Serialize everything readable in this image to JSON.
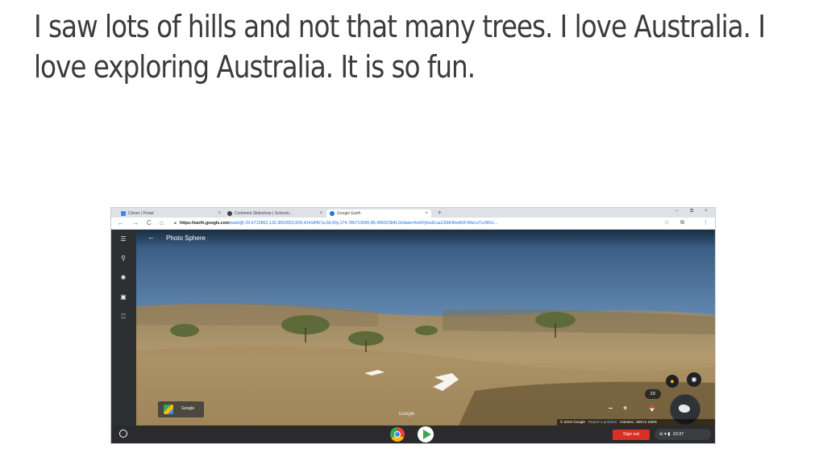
{
  "slide": {
    "text": "I saw lots of hills and not that many trees. I love Australia. I love exploring Australia. It is so fun."
  },
  "browser": {
    "tabs": [
      {
        "label": "Clever | Portal",
        "color": "#4285f4",
        "active": false
      },
      {
        "label": "Continent Slideshow | Schoolo...",
        "color": "#3c4043",
        "active": false
      },
      {
        "label": "Google Earth",
        "color": "#1a73e8",
        "active": true
      }
    ],
    "tab_close": "×",
    "new_tab": "+",
    "window_controls": [
      "–",
      "⧉",
      "×"
    ],
    "url_host": "https://earth.google.com",
    "url_path": "/web/@-23.6713862,132.3652652,829.41418457a,0d,60y,174.78671359h,85.49552384t,0r/data=ihoKFjhsdi1sa2J0dHNoM1F4NzcxTzJiR2c...",
    "nav": {
      "back": "←",
      "forward": "→",
      "reload": "C",
      "home": "⌂"
    },
    "toolbar_icons": {
      "star": "☆",
      "extension": "⧉",
      "menu": "⋮"
    }
  },
  "earth": {
    "view_title": "Photo Sphere",
    "back": "←",
    "rail_icons": [
      "☰",
      "⚲",
      "✺",
      "▣",
      "⎕"
    ],
    "thumb_label": "Google",
    "google_mark": "Google",
    "footer": {
      "copyright": "© 2019 Google",
      "report": "Report a problem",
      "camera": "Camera : 829 m  100%"
    },
    "btn_2d": "2D",
    "zoom_minus": "–",
    "zoom_plus": "+"
  },
  "shelf": {
    "sign_out": "Sign out",
    "time": "10:37",
    "tray_icons": "⊖ ▾ ▮"
  }
}
